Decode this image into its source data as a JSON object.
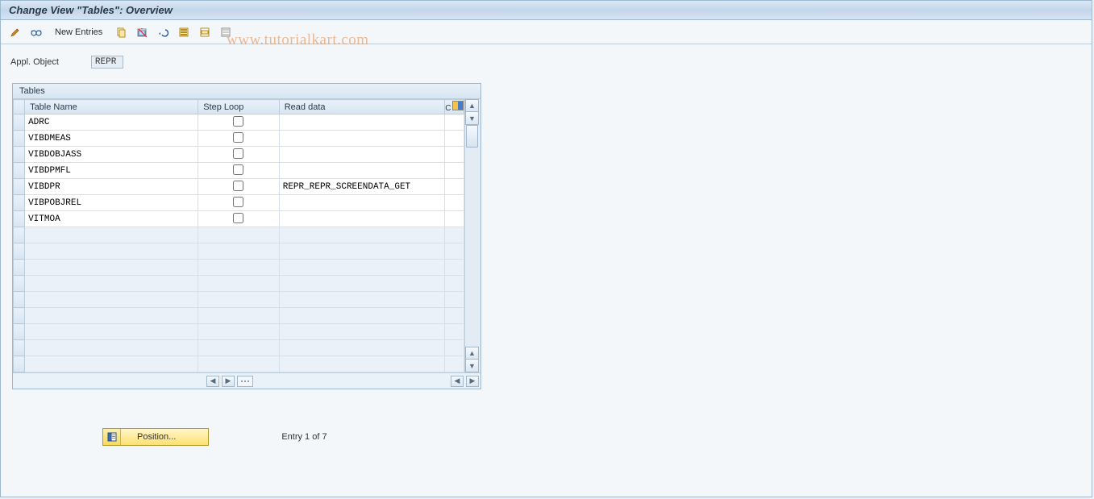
{
  "title": "Change View \"Tables\": Overview",
  "toolbar": {
    "new_entries_label": "New Entries",
    "icons": {
      "toggle": "toggle-display-change-icon",
      "glasses": "details-icon",
      "copy": "copy-icon",
      "delete": "delete-icon",
      "undo": "undo-icon",
      "select_all": "select-all-icon",
      "select_block": "select-block-icon",
      "deselect_all": "deselect-all-icon"
    }
  },
  "watermark": "www.tutorialkart.com",
  "form": {
    "appl_object_label": "Appl. Object",
    "appl_object_value": "REPR"
  },
  "table": {
    "caption": "Tables",
    "columns": {
      "name": "Table Name",
      "step": "Step Loop",
      "read": "Read data",
      "ctrl": "C"
    },
    "rows": [
      {
        "name": "ADRC",
        "step": false,
        "read": ""
      },
      {
        "name": "VIBDMEAS",
        "step": false,
        "read": ""
      },
      {
        "name": "VIBDOBJASS",
        "step": false,
        "read": ""
      },
      {
        "name": "VIBDPMFL",
        "step": false,
        "read": ""
      },
      {
        "name": "VIBDPR",
        "step": false,
        "read": "REPR_REPR_SCREENDATA_GET"
      },
      {
        "name": "VIBPOBJREL",
        "step": false,
        "read": ""
      },
      {
        "name": "VITMOA",
        "step": false,
        "read": ""
      }
    ],
    "empty_rows": 9
  },
  "footer": {
    "position_label": "Position...",
    "entry_text": "Entry 1 of 7"
  }
}
